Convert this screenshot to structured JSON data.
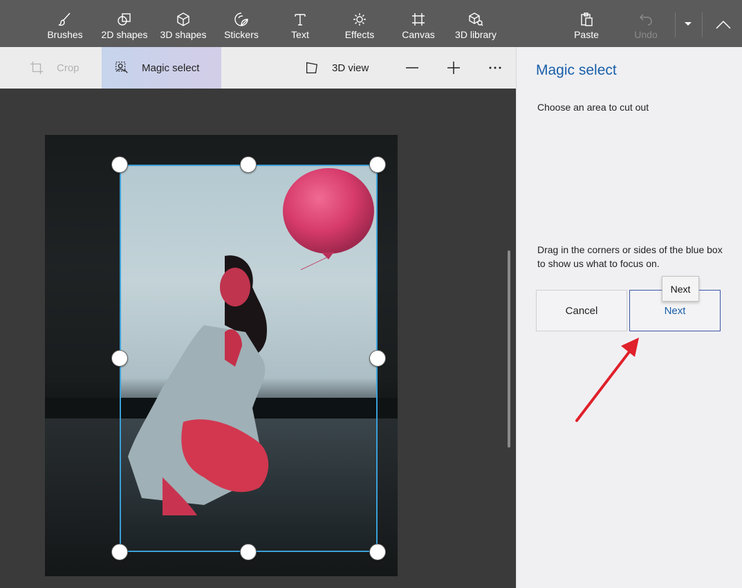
{
  "toolbar": {
    "items": [
      {
        "label": "Brushes",
        "icon": "brush-icon"
      },
      {
        "label": "2D shapes",
        "icon": "2d-shapes-icon"
      },
      {
        "label": "3D shapes",
        "icon": "3d-shapes-icon"
      },
      {
        "label": "Stickers",
        "icon": "sticker-icon"
      },
      {
        "label": "Text",
        "icon": "text-icon"
      },
      {
        "label": "Effects",
        "icon": "effects-icon"
      },
      {
        "label": "Canvas",
        "icon": "canvas-icon"
      },
      {
        "label": "3D library",
        "icon": "3d-library-icon"
      }
    ],
    "paste_label": "Paste",
    "undo_label": "Undo"
  },
  "subbar": {
    "crop_label": "Crop",
    "magic_label": "Magic select",
    "view3d_label": "3D view"
  },
  "panel": {
    "title": "Magic select",
    "subtitle": "Choose an area to cut out",
    "help": "Drag in the corners or sides of the blue box to show us what to focus on.",
    "cancel_label": "Cancel",
    "next_label": "Next",
    "tooltip": "Next"
  },
  "colors": {
    "toolbar_bg": "#5b5b5b",
    "panel_title": "#1a5fa8",
    "selection_border": "#3aa0d8",
    "annotation_arrow": "#e0202a"
  }
}
